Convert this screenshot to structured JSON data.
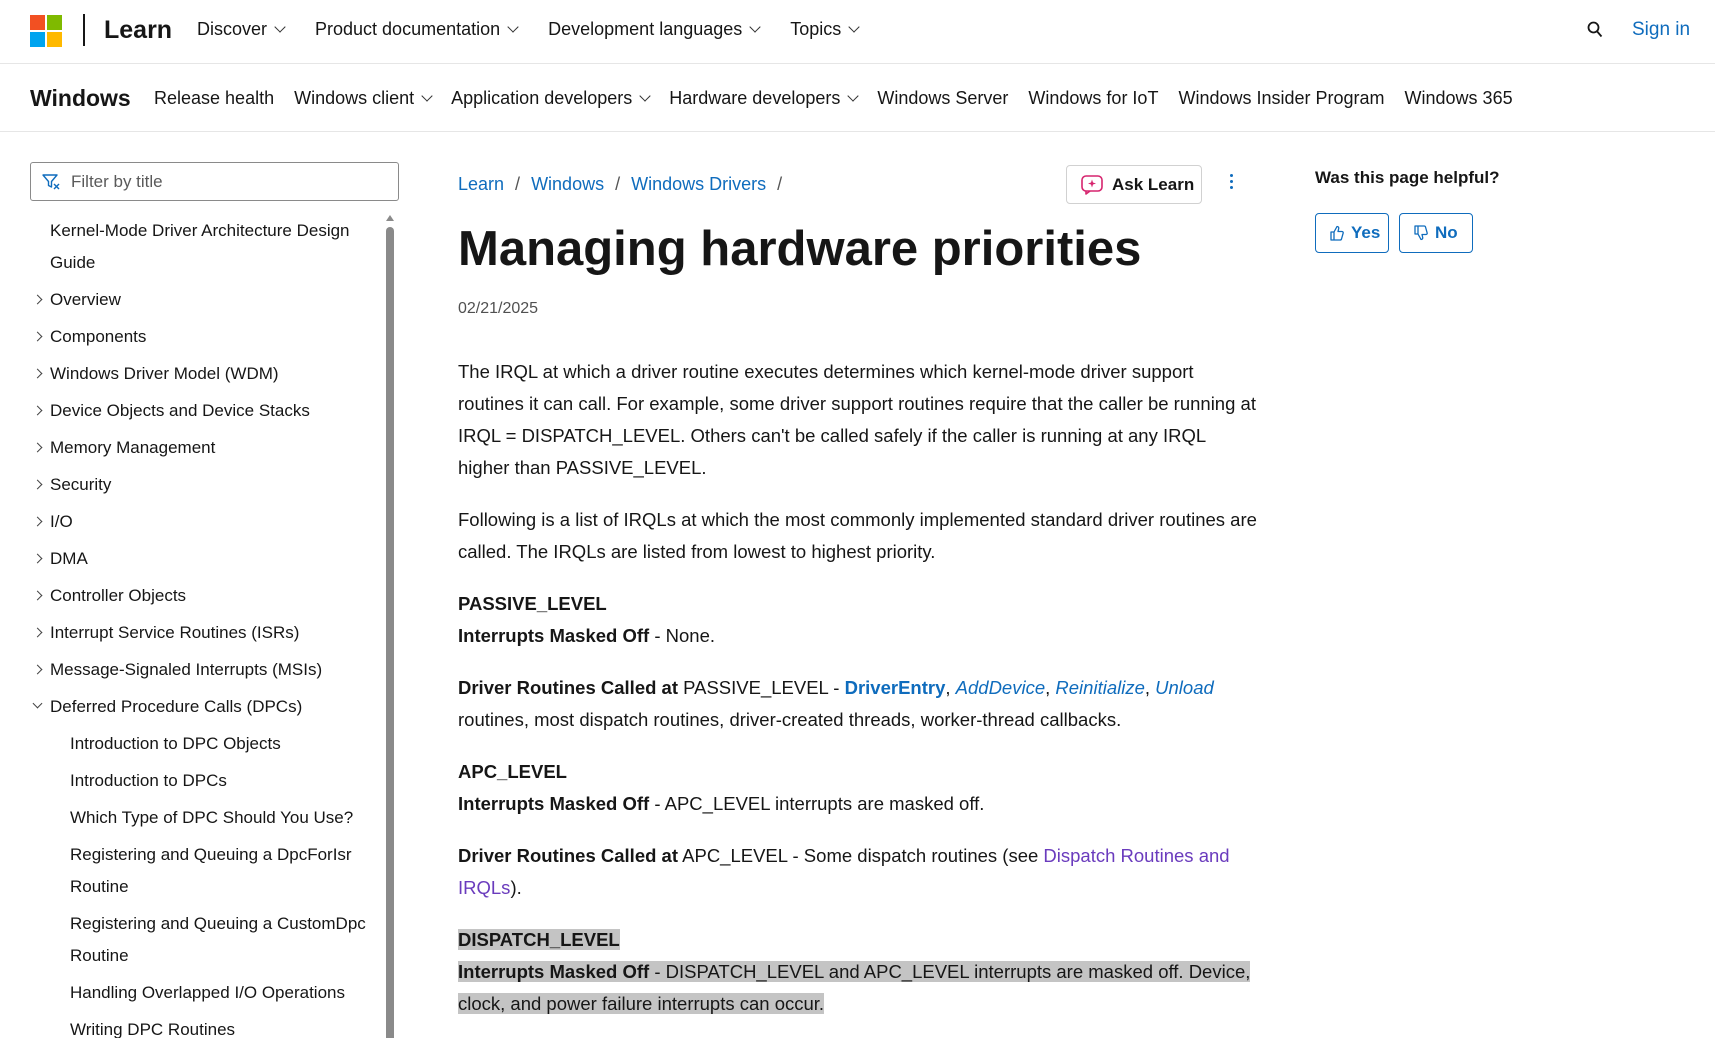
{
  "header": {
    "brand": "Learn",
    "nav": [
      {
        "label": "Discover",
        "dropdown": true
      },
      {
        "label": "Product documentation",
        "dropdown": true
      },
      {
        "label": "Development languages",
        "dropdown": true
      },
      {
        "label": "Topics",
        "dropdown": true
      }
    ],
    "sign_in": "Sign in"
  },
  "subheader": {
    "brand": "Windows",
    "nav": [
      {
        "label": "Release health",
        "dropdown": false
      },
      {
        "label": "Windows client",
        "dropdown": true
      },
      {
        "label": "Application developers",
        "dropdown": true
      },
      {
        "label": "Hardware developers",
        "dropdown": true
      },
      {
        "label": "Windows Server",
        "dropdown": false
      },
      {
        "label": "Windows for IoT",
        "dropdown": false
      },
      {
        "label": "Windows Insider Program",
        "dropdown": false
      },
      {
        "label": "Windows 365",
        "dropdown": false
      }
    ]
  },
  "sidebar": {
    "filter_placeholder": "Filter by title",
    "toc": [
      {
        "label": "Kernel-Mode Driver Architecture Design Guide",
        "level": 0,
        "arrow": "none"
      },
      {
        "label": "Overview",
        "level": 1,
        "arrow": "closed"
      },
      {
        "label": "Components",
        "level": 1,
        "arrow": "closed"
      },
      {
        "label": "Windows Driver Model (WDM)",
        "level": 1,
        "arrow": "closed"
      },
      {
        "label": "Device Objects and Device Stacks",
        "level": 1,
        "arrow": "closed"
      },
      {
        "label": "Memory Management",
        "level": 1,
        "arrow": "closed"
      },
      {
        "label": "Security",
        "level": 1,
        "arrow": "closed"
      },
      {
        "label": "I/O",
        "level": 1,
        "arrow": "closed"
      },
      {
        "label": "DMA",
        "level": 1,
        "arrow": "closed"
      },
      {
        "label": "Controller Objects",
        "level": 1,
        "arrow": "closed"
      },
      {
        "label": "Interrupt Service Routines (ISRs)",
        "level": 1,
        "arrow": "closed"
      },
      {
        "label": "Message-Signaled Interrupts (MSIs)",
        "level": 1,
        "arrow": "closed"
      },
      {
        "label": "Deferred Procedure Calls (DPCs)",
        "level": 1,
        "arrow": "open"
      },
      {
        "label": "Introduction to DPC Objects",
        "level": 2,
        "arrow": "none"
      },
      {
        "label": "Introduction to DPCs",
        "level": 2,
        "arrow": "none"
      },
      {
        "label": "Which Type of DPC Should You Use?",
        "level": 2,
        "arrow": "none"
      },
      {
        "label": "Registering and Queuing a DpcForIsr Routine",
        "level": 2,
        "arrow": "none"
      },
      {
        "label": "Registering and Queuing a CustomDpc Routine",
        "level": 2,
        "arrow": "none"
      },
      {
        "label": "Handling Overlapped I/O Operations",
        "level": 2,
        "arrow": "none"
      },
      {
        "label": "Writing DPC Routines",
        "level": 2,
        "arrow": "none"
      }
    ]
  },
  "breadcrumb": [
    "Learn",
    "Windows",
    "Windows Drivers"
  ],
  "breadcrumb_sep": "/",
  "ask_learn": "Ask Learn",
  "article": {
    "title": "Managing hardware priorities",
    "date": "02/21/2025",
    "p1": "The IRQL at which a driver routine executes determines which kernel-mode driver support routines it can call. For example, some driver support routines require that the caller be running at IRQL = DISPATCH_LEVEL. Others can't be called safely if the caller is running at any IRQL higher than PASSIVE_LEVEL.",
    "p2": "Following is a list of IRQLs at which the most commonly implemented standard driver routines are called. The IRQLs are listed from lowest to highest priority.",
    "passive": {
      "level": "PASSIVE_LEVEL",
      "masked_label": "Interrupts Masked Off",
      "masked_text": " - None.",
      "called_label": "Driver Routines Called at",
      "called_text": " PASSIVE_LEVEL - ",
      "link_driverentry": "DriverEntry",
      "link_adddevice": "AddDevice",
      "link_reinitialize": "Reinitialize",
      "link_unload": "Unload",
      "comma": ", ",
      "tail": " routines, most dispatch routines, driver-created threads, worker-thread callbacks."
    },
    "apc": {
      "level": "APC_LEVEL",
      "masked_label": "Interrupts Masked Off",
      "masked_text": " - APC_LEVEL interrupts are masked off.",
      "called_label": "Driver Routines Called at",
      "called_text": " APC_LEVEL - Some dispatch routines (see ",
      "link_dispatch": "Dispatch Routines and IRQLs",
      "tail": ")."
    },
    "dispatch": {
      "level": "DISPATCH_LEVEL",
      "masked_label": "Interrupts Masked Off",
      "masked_text": " - DISPATCH_LEVEL and APC_LEVEL interrupts are masked off. Device, clock, and power failure interrupts can occur."
    }
  },
  "feedback": {
    "question": "Was this page helpful?",
    "yes": "Yes",
    "no": "No"
  },
  "colors": {
    "link": "#0f6cbd",
    "visited_link": "#6a3bbd",
    "highlight": "#c4c4c4",
    "ms_red": "#f25022",
    "ms_green": "#7fba00",
    "ms_blue": "#00a4ef",
    "ms_yellow": "#ffb900"
  },
  "icons": [
    "microsoft-logo",
    "chevron-down-icon",
    "search-icon",
    "filter-icon",
    "chevron-right-icon",
    "ask-learn-icon",
    "more-options-icon",
    "thumbs-up-icon",
    "thumbs-down-icon"
  ]
}
